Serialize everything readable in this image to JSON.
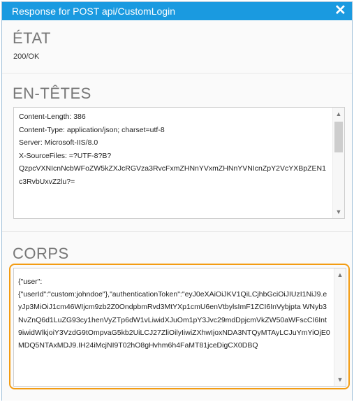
{
  "dialog": {
    "title": "Response for POST api/CustomLogin",
    "close_icon": "close-icon"
  },
  "status_section": {
    "heading": "ÉTAT",
    "value": "200/OK"
  },
  "headers_section": {
    "heading": "EN-TÊTES",
    "lines": [
      "Content-Length: 386",
      "Content-Type: application/json; charset=utf-8",
      "Server: Microsoft-IIS/8.0",
      "X-SourceFiles: =?UTF-8?B?",
      "QzpcVXNIcnNcbWFoZW5kZXJcRGVza3RvcFxmZHNnYVxmZHNnYVNIcnZpY2VcYXBpZEN1",
      "c3RvbUxvZ2lu?="
    ]
  },
  "body_section": {
    "heading": "CORPS",
    "text": "{\"user\":\n{\"userId\":\"custom:johndoe\"},\"authenticationToken\":\"eyJ0eXAiOiJKV1QiLCjhbGciOiJIUzI1NiJ9.eyJp3MiOiJ1cm46WIjcm9zb2Z0OndpbmRvd3MtYXp1cmU6enVtbylsImF1ZCI6InVybjpta WNyb3NvZnQ6d1LuZG93cy1henVyZTp6dW1vLiwidXJuOm1pY3Jvc29mdDpjcmVkZW50aWFscCI6Int9iwidWlkjoiY3VzdG9tOmpvaG5kb2UiLCJ27ZliOilyIiwiZXhwIjoxNDA3NTQyMTAyLCJuYmYiOjE0MDQ5NTAxMDJ9.IH24iMcjNI9T02hO8gHvhm6h4FaMT81jceDigCX0DBQ"
  },
  "scrollbar": {
    "up_icon": "scroll-up-icon",
    "down_icon": "scroll-down-icon"
  }
}
